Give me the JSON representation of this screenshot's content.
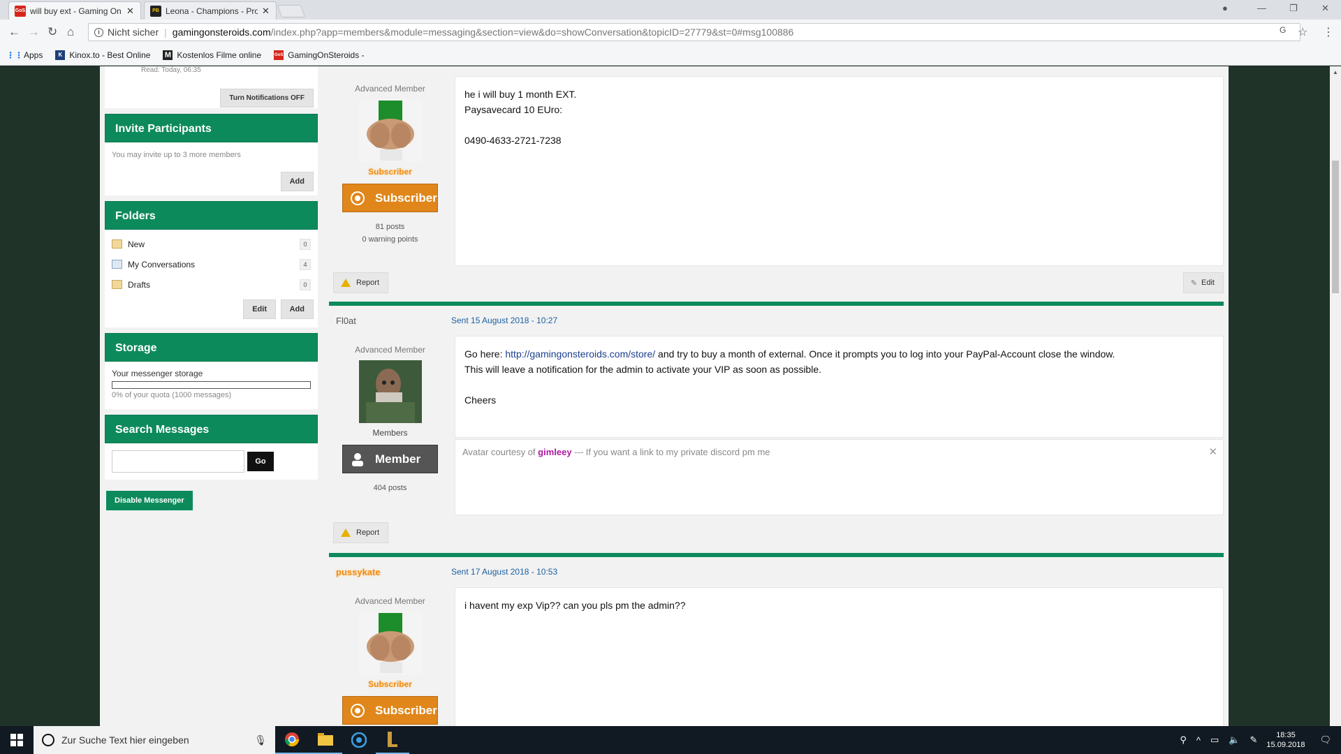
{
  "browser": {
    "tabs": [
      {
        "title": "will buy ext - Gaming On",
        "icon": "gos-icon",
        "color": "#d6261c",
        "active": true
      },
      {
        "title": "Leona - Champions - Pro",
        "icon": "pb-icon",
        "color": "#222222",
        "active": false
      }
    ],
    "security_label": "Nicht sicher",
    "url_host": "gamingonsteroids.com",
    "url_path": "/index.php?app=members&module=messaging&section=view&do=showConversation&topicID=27779&st=0#msg100886",
    "bookmarks": [
      {
        "label": "Apps",
        "icon": "apps-grid-icon"
      },
      {
        "label": "Kinox.to - Best Online",
        "icon": "kinox-icon"
      },
      {
        "label": "Kostenlos Filme online",
        "icon": "m-icon"
      },
      {
        "label": "GamingOnSteroids -",
        "icon": "gos-icon"
      }
    ]
  },
  "sidebar": {
    "read_label": "Read: Today, 06:35",
    "notifications_btn": "Turn Notifications OFF",
    "invite": {
      "title": "Invite Participants",
      "text": "You may invite up to 3 more members",
      "add": "Add"
    },
    "folders": {
      "title": "Folders",
      "items": [
        {
          "label": "New",
          "count": "0"
        },
        {
          "label": "My Conversations",
          "count": "4"
        },
        {
          "label": "Drafts",
          "count": "0"
        }
      ],
      "edit": "Edit",
      "add": "Add"
    },
    "storage": {
      "title": "Storage",
      "label": "Your messenger storage",
      "quota": "0% of your quota (1000 messages)",
      "used_fraction": 0
    },
    "search": {
      "title": "Search Messages",
      "placeholder": "",
      "go": "Go"
    },
    "disable_btn": "Disable Messenger"
  },
  "posts": [
    {
      "rank": "Advanced Member",
      "group": "Subscriber",
      "badge": "Subscriber",
      "posts": "81 posts",
      "warnings": "0 warning points",
      "lines": [
        "he i will buy 1 month EXT.",
        "Paysavecard 10 EUro:",
        "",
        "0490-4633-2721-7238"
      ],
      "report": "Report",
      "edit": "Edit"
    },
    {
      "author": "Fl0at",
      "date": "Sent 15 August 2018 - 10:27",
      "rank": "Advanced Member",
      "group": "Members",
      "badge": "Member",
      "posts": "404 posts",
      "line1_pre": "Go here: ",
      "line1_link": "http://gamingonsteroids.com/store/",
      "line1_post": " and try to buy a month of external. Once it prompts you to log into your PayPal-Account close the window.",
      "line2": "This will leave a notification for the admin to activate your VIP as soon as possible.",
      "line3": "Cheers",
      "sig_pre": "Avatar courtesy of ",
      "sig_link": "gimleey",
      "sig_post": " --- If you want a link to my private discord pm me",
      "report": "Report"
    },
    {
      "author": "pussykate",
      "date": "Sent 17 August 2018 - 10:53",
      "rank": "Advanced Member",
      "group": "Subscriber",
      "badge": "Subscriber",
      "text": "i havent my exp Vip?? can you pls pm the admin??"
    }
  ],
  "taskbar": {
    "search_placeholder": "Zur Suche Text hier eingeben",
    "time": "18:35",
    "date": "15.09.2018"
  },
  "colors": {
    "accent": "#0d8a5c",
    "subscriber": "#e0861a",
    "link": "#1a3f8f"
  }
}
